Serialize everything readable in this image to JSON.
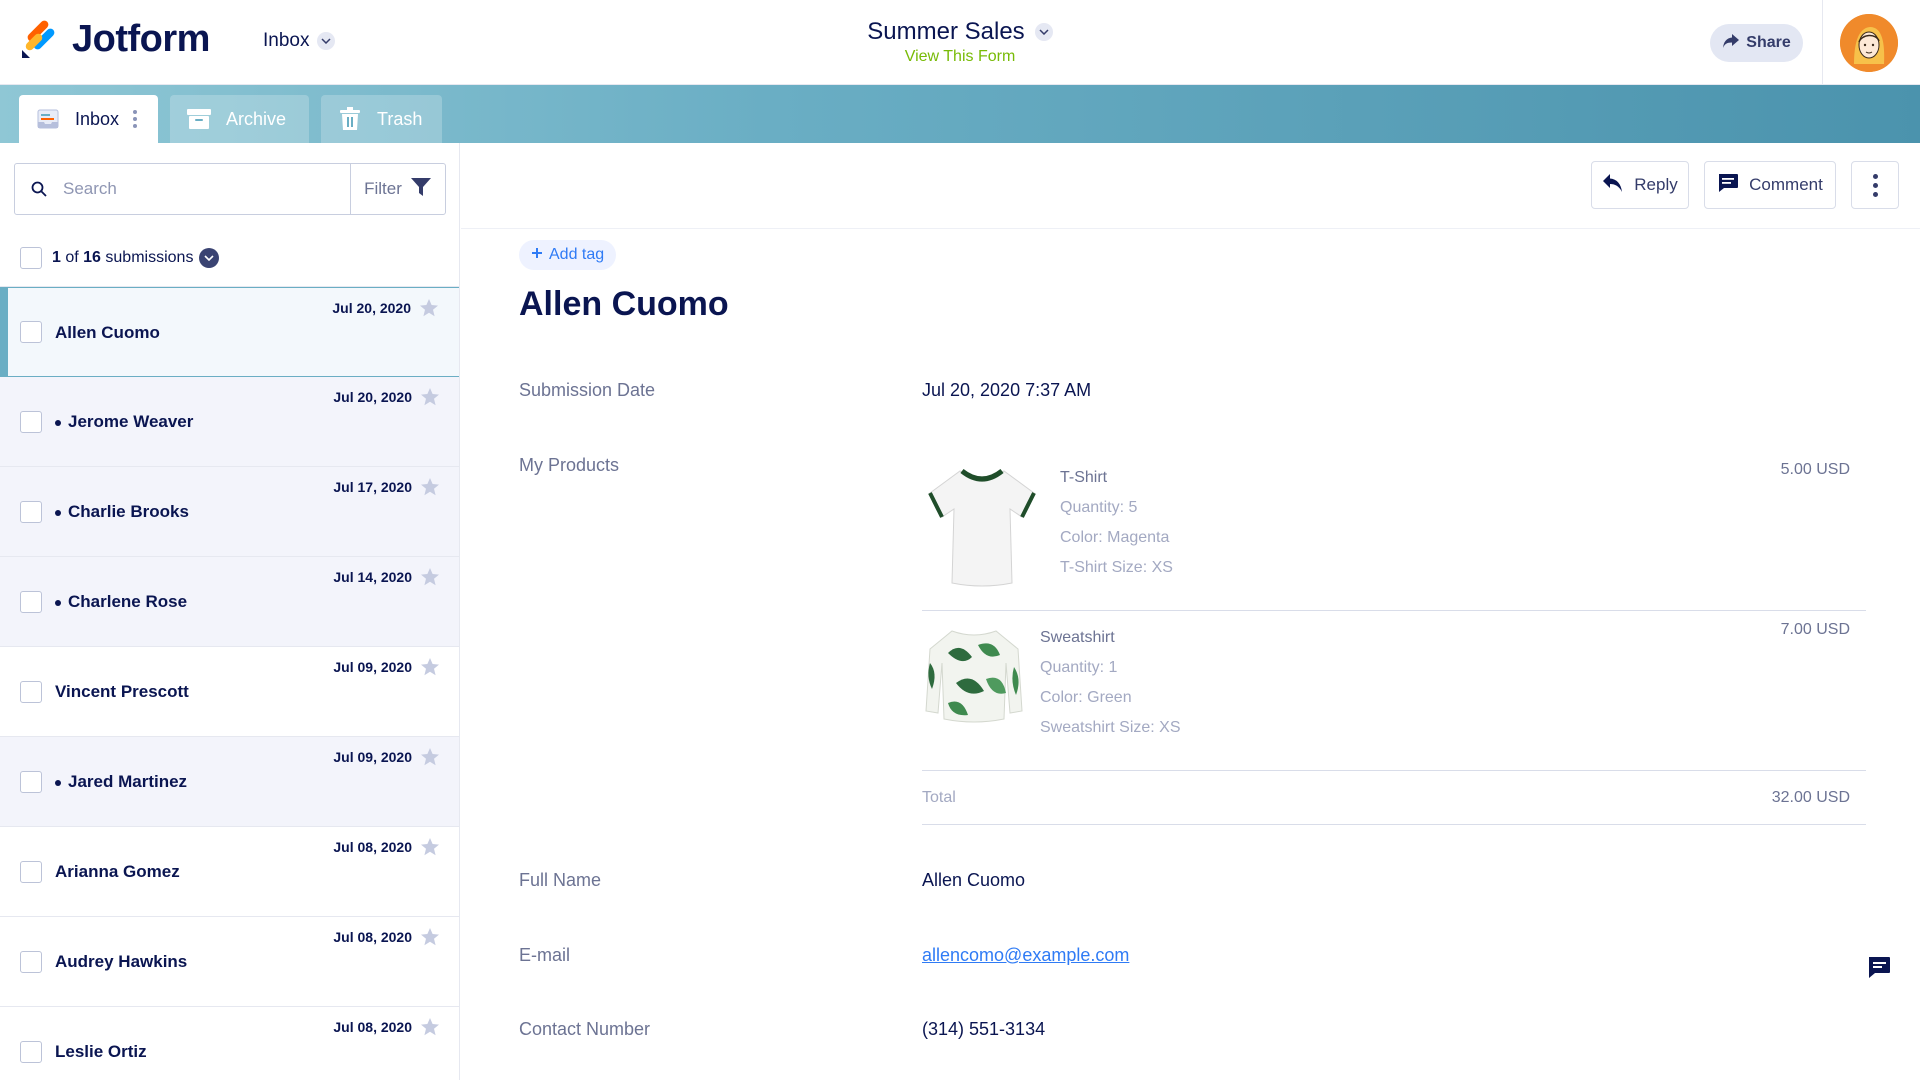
{
  "header": {
    "brand": "Jotform",
    "inbox_dropdown": "Inbox",
    "form_title": "Summer Sales",
    "view_form": "View This Form",
    "share_label": "Share"
  },
  "tabs": [
    {
      "label": "Inbox",
      "active": true
    },
    {
      "label": "Archive",
      "active": false
    },
    {
      "label": "Trash",
      "active": false
    }
  ],
  "sidebar": {
    "search_placeholder": "Search",
    "filter_label": "Filter",
    "count": {
      "current": "1",
      "of": "of",
      "total": "16",
      "suffix": "submissions"
    },
    "submissions": [
      {
        "name": "Allen Cuomo",
        "date": "Jul 20, 2020",
        "unread": false,
        "selected": true
      },
      {
        "name": "Jerome Weaver",
        "date": "Jul 20, 2020",
        "unread": true,
        "selected": false
      },
      {
        "name": "Charlie Brooks",
        "date": "Jul 17, 2020",
        "unread": true,
        "selected": false
      },
      {
        "name": "Charlene Rose",
        "date": "Jul 14, 2020",
        "unread": true,
        "selected": false
      },
      {
        "name": "Vincent Prescott",
        "date": "Jul 09, 2020",
        "unread": false,
        "selected": false
      },
      {
        "name": "Jared Martinez",
        "date": "Jul 09, 2020",
        "unread": true,
        "selected": false
      },
      {
        "name": "Arianna Gomez",
        "date": "Jul 08, 2020",
        "unread": false,
        "selected": false
      },
      {
        "name": "Audrey Hawkins",
        "date": "Jul 08, 2020",
        "unread": false,
        "selected": false
      },
      {
        "name": "Leslie Ortiz",
        "date": "Jul 08, 2020",
        "unread": false,
        "selected": false
      }
    ]
  },
  "actions": {
    "reply_label": "Reply",
    "comment_label": "Comment"
  },
  "detail": {
    "add_tag": "Add tag",
    "name": "Allen Cuomo",
    "submission_date_label": "Submission Date",
    "submission_date": "Jul 20, 2020 7:37 AM",
    "products_label": "My Products",
    "products": [
      {
        "name": "T-Shirt",
        "quantity": "Quantity: 5",
        "color": "Color: Magenta",
        "size": "T-Shirt Size: XS",
        "price": "5.00 USD"
      },
      {
        "name": "Sweatshirt",
        "quantity": "Quantity: 1",
        "color": "Color: Green",
        "size": "Sweatshirt Size: XS",
        "price": "7.00 USD"
      }
    ],
    "total_label": "Total",
    "total_value": "32.00 USD",
    "full_name_label": "Full Name",
    "full_name": "Allen Cuomo",
    "email_label": "E-mail",
    "email": "allencomo@example.com",
    "contact_label": "Contact Number",
    "contact": "(314) 551-3134"
  },
  "colors": {
    "navy": "#0a1551",
    "accent_green": "#78bb07",
    "link_blue": "#2f7bf5",
    "tab_band": "#6aaec4",
    "logo_orange": "#ff6100",
    "logo_blue": "#0099ff",
    "logo_yellow": "#ffb629"
  },
  "icons": [
    "jotform-logo-icon",
    "chevron-down-icon",
    "share-arrow-icon",
    "avatar",
    "inbox-tab-icon",
    "archive-icon",
    "trash-icon",
    "search-icon",
    "filter-funnel-icon",
    "star-icon",
    "reply-arrow-icon",
    "comment-icon",
    "more-vertical-icon",
    "plus-icon",
    "tshirt-image",
    "sweatshirt-image",
    "chat-bubble-icon"
  ]
}
